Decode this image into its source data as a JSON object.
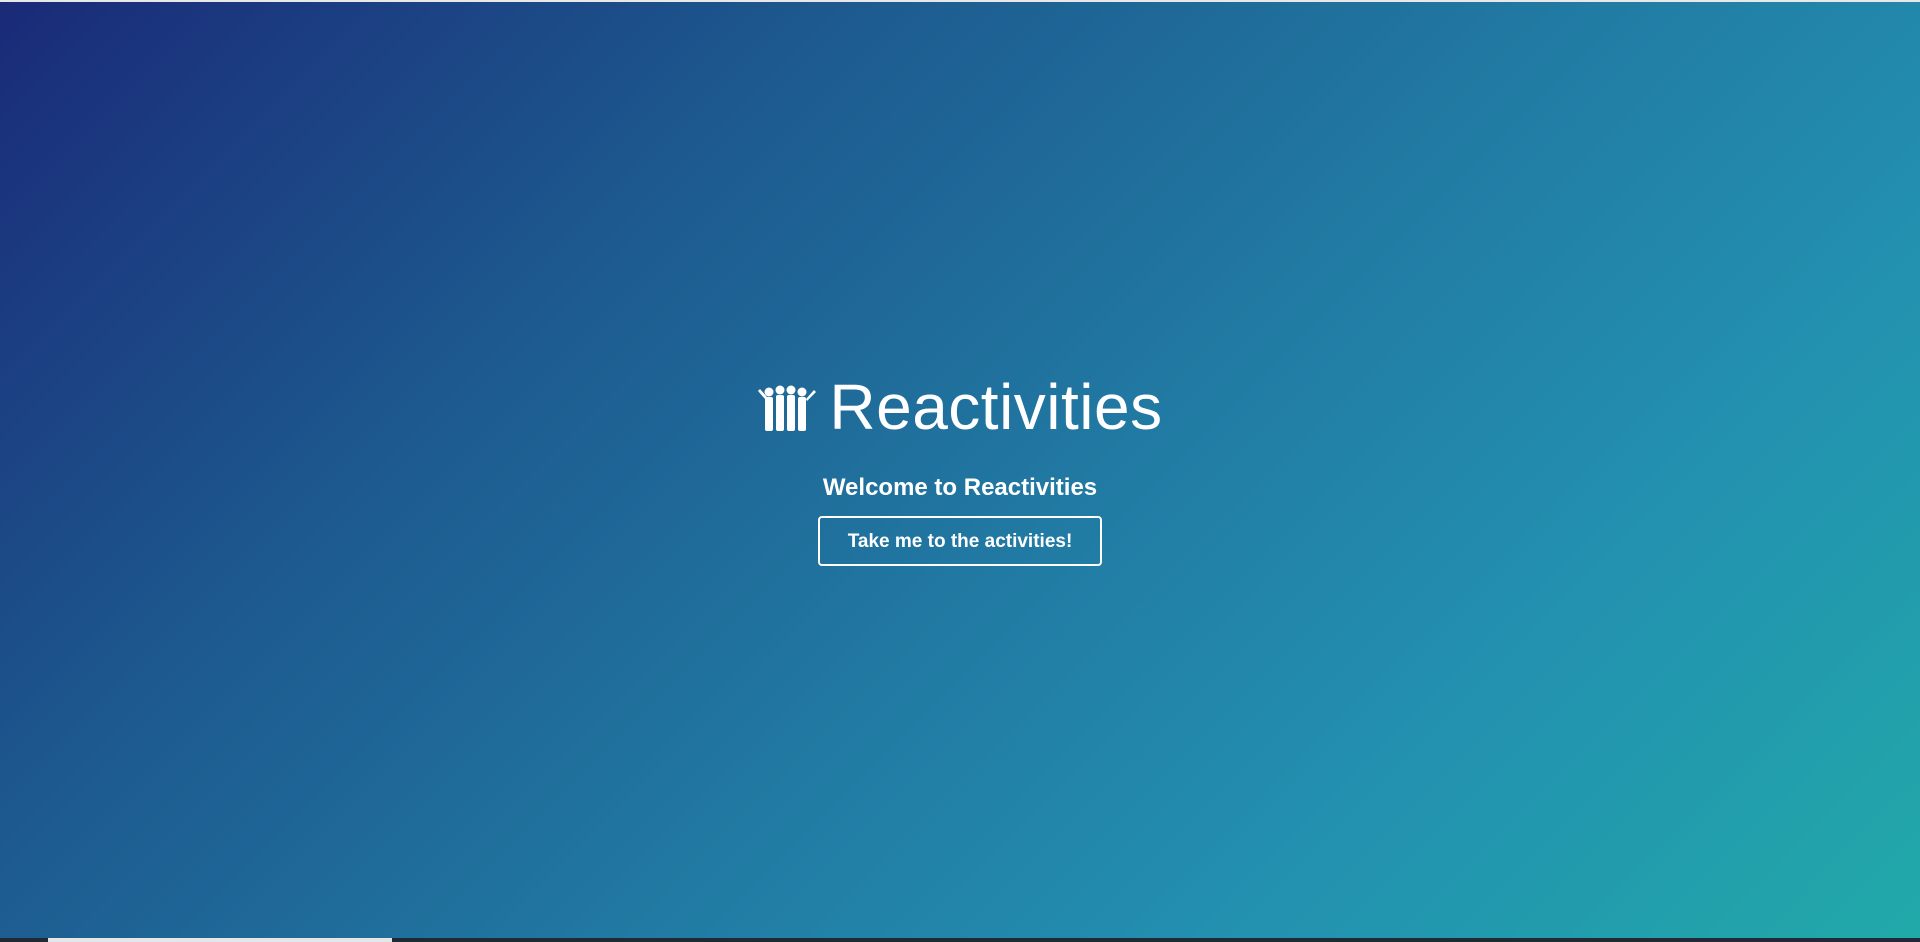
{
  "masthead": {
    "title": "Reactivities",
    "logo_icon": "group-of-people-icon",
    "subtitle": "Welcome to Reactivities",
    "cta_label": "Take me to the activities!"
  },
  "colors": {
    "gradient_start": "#1a2a78",
    "gradient_mid": "#217aa3",
    "gradient_end": "#21a9a9",
    "text": "#ffffff"
  }
}
